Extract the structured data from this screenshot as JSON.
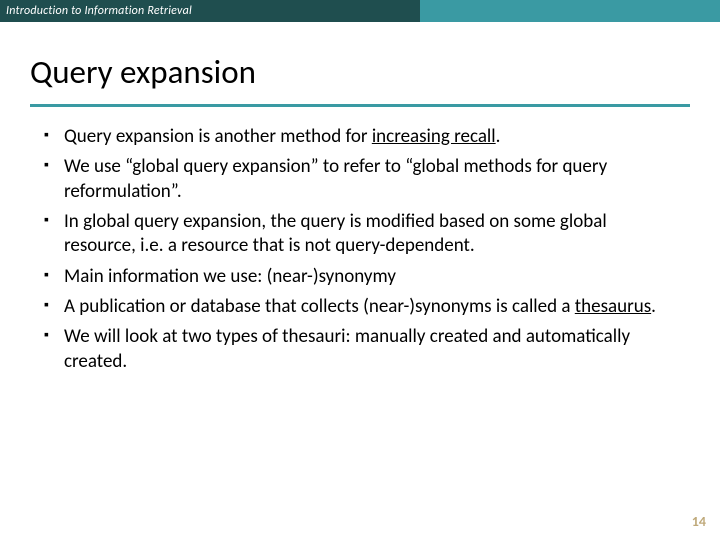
{
  "header": {
    "course": "Introduction to Information Retrieval"
  },
  "title": "Query expansion",
  "bullets": [
    {
      "pre": "Query expansion is another method for ",
      "highlight": "increasing recall",
      "post": "."
    },
    {
      "pre": "We use “global query expansion” to refer to “global methods for query reformulation”.",
      "highlight": "",
      "post": ""
    },
    {
      "pre": "In global query expansion, the query is modified based on some global resource, i.e. a resource that is not query-dependent.",
      "highlight": "",
      "post": ""
    },
    {
      "pre": "Main information we use: (near-)synonymy",
      "highlight": "",
      "post": ""
    },
    {
      "pre": "A publication or database that collects (near-)synonyms is called a ",
      "highlight": "thesaurus",
      "post": "."
    },
    {
      "pre": "We will look at two types of thesauri: manually created and automatically created.",
      "highlight": "",
      "post": ""
    }
  ],
  "page_number": "14"
}
